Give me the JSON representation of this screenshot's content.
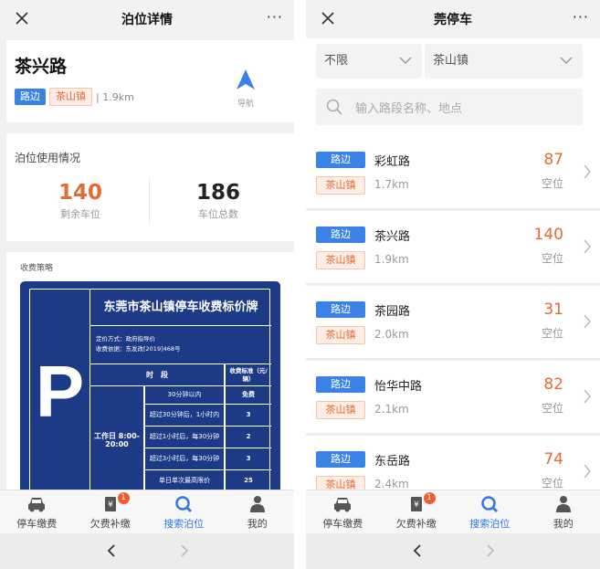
{
  "left": {
    "title": "泊位详情",
    "more": "···",
    "road_name": "茶兴路",
    "tag_type": "路边",
    "tag_town": "茶山镇",
    "distance": "| 1.9km",
    "nav_label": "导航",
    "usage_header": "泊位使用情况",
    "remaining_num": "140",
    "remaining_label": "剩余车位",
    "total_num": "186",
    "total_label": "车位总数",
    "fee_header": "收费策略",
    "board": {
      "p": "P",
      "title": "东莞市茶山镇停车收费标价牌",
      "info1": "定价方式：政府指导价",
      "info2": "收费依据：东发改[2019]468号",
      "col_time": "时　段",
      "col_std": "收费标准（元/辆）",
      "period": "工作日 8:00-20:00",
      "rows": [
        {
          "label": "30分钟以内",
          "price": "免费"
        },
        {
          "label": "超过30分钟后，1小时内",
          "price": "3"
        },
        {
          "label": "超过1小时后，每30分钟",
          "price": "2"
        },
        {
          "label": "超过3小时后，每30分钟",
          "price": "3"
        },
        {
          "label": "单日单次最高限价",
          "price": "25"
        }
      ]
    }
  },
  "right": {
    "title": "莞停车",
    "more": "···",
    "filter1": "不限",
    "filter2": "茶山镇",
    "search_placeholder": "输入路段名称、地点",
    "items": [
      {
        "type": "路边",
        "town": "茶山镇",
        "name": "彩虹路",
        "distance": "1.7km",
        "count": "87",
        "count_label": "空位"
      },
      {
        "type": "路边",
        "town": "茶山镇",
        "name": "茶兴路",
        "distance": "1.9km",
        "count": "140",
        "count_label": "空位"
      },
      {
        "type": "路边",
        "town": "茶山镇",
        "name": "茶园路",
        "distance": "2.0km",
        "count": "31",
        "count_label": "空位"
      },
      {
        "type": "路边",
        "town": "茶山镇",
        "name": "怡华中路",
        "distance": "2.1km",
        "count": "82",
        "count_label": "空位"
      },
      {
        "type": "路边",
        "town": "茶山镇",
        "name": "东岳路",
        "distance": "2.4km",
        "count": "74",
        "count_label": "空位"
      }
    ]
  },
  "tabs": [
    {
      "label": "停车缴费",
      "icon": "car-icon"
    },
    {
      "label": "欠费补缴",
      "icon": "yen-bill-icon",
      "badge": "1"
    },
    {
      "label": "搜索泊位",
      "icon": "search-icon"
    },
    {
      "label": "我的",
      "icon": "person-icon"
    }
  ],
  "colors": {
    "accent": "#2f78e0",
    "orange": "#e36b34",
    "board_blue": "#1c3a86"
  }
}
